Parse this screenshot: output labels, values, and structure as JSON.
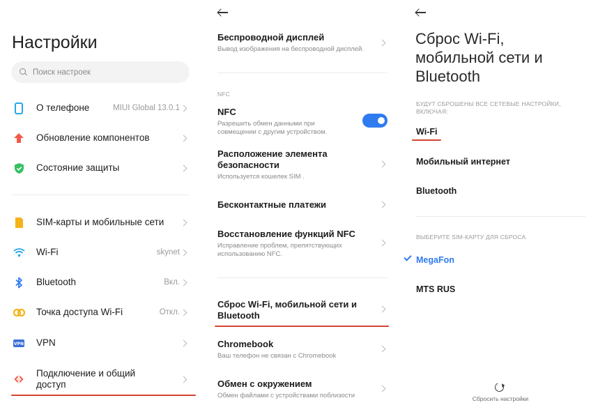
{
  "panel1": {
    "title": "Настройки",
    "search_placeholder": "Поиск настроек",
    "items": [
      {
        "label": "О телефоне",
        "value": "MIUI Global 13.0.1",
        "icon": "phone-icon",
        "color": "#2aa7e8"
      },
      {
        "label": "Обновление компонентов",
        "value": "",
        "icon": "arrow-up-icon",
        "color": "#f25a47"
      },
      {
        "label": "Состояние защиты",
        "value": "",
        "icon": "shield-icon",
        "color": "#35c062"
      },
      {
        "label": "SIM-карты и мобильные сети",
        "value": "",
        "icon": "sim-card-icon",
        "color": "#f5b319"
      },
      {
        "label": "Wi-Fi",
        "value": "skynet",
        "icon": "wifi-icon",
        "color": "#2aa7e8"
      },
      {
        "label": "Bluetooth",
        "value": "Вкл.",
        "icon": "bluetooth-icon",
        "color": "#2f7bf0"
      },
      {
        "label": "Точка доступа Wi-Fi",
        "value": "Откл.",
        "icon": "hotspot-icon",
        "color": "#f5b319"
      },
      {
        "label": "VPN",
        "value": "",
        "icon": "vpn-icon",
        "color": "#3b6fd8"
      },
      {
        "label": "Подключение и общий доступ",
        "value": "",
        "icon": "connection-icon",
        "color": "#f25a47"
      }
    ]
  },
  "panel2": {
    "items": [
      {
        "title": "Беспроводной дисплей",
        "subtitle": "Вывод изображения на беспроводной дисплей."
      },
      {
        "title": "NFC",
        "subtitle": "Разрешить обмен данными при совмещении с другим устройством."
      },
      {
        "title": "Расположение элемента безопасности",
        "subtitle": "Используется кошелек SIM ."
      },
      {
        "title": "Бесконтактные платежи",
        "subtitle": ""
      },
      {
        "title": "Восстановление функций NFC",
        "subtitle": "Исправление проблем, препятствующих использованию NFC."
      },
      {
        "title": "Сброс Wi-Fi, мобильной сети и Bluetooth",
        "subtitle": ""
      },
      {
        "title": "Chromebook",
        "subtitle": "Ваш телефон не связан с Chromebook"
      },
      {
        "title": "Обмен с окружением",
        "subtitle": "Обмен файлами с устройствами поблизости"
      }
    ],
    "section_nfc": "NFC",
    "nfc_enabled": true,
    "accent": "#2f7bf0"
  },
  "panel3": {
    "title": "Сброс Wi-Fi, мобильной сети и Bluetooth",
    "reset_label": "БУДУТ СБРОШЕНЫ ВСЕ СЕТЕВЫЕ НАСТРОЙКИ, ВКЛЮЧАЯ:",
    "reset_items": [
      "Wi-Fi",
      "Мобильный интернет",
      "Bluetooth"
    ],
    "sim_label": "ВЫБЕРИТЕ SIM-КАРТУ ДЛЯ СБРОСА",
    "sim_options": [
      "MegaFon",
      "MTS RUS"
    ],
    "selected_sim": "MegaFon",
    "action_label": "Сбросить настройки"
  },
  "highlight_color": "#d4442f"
}
